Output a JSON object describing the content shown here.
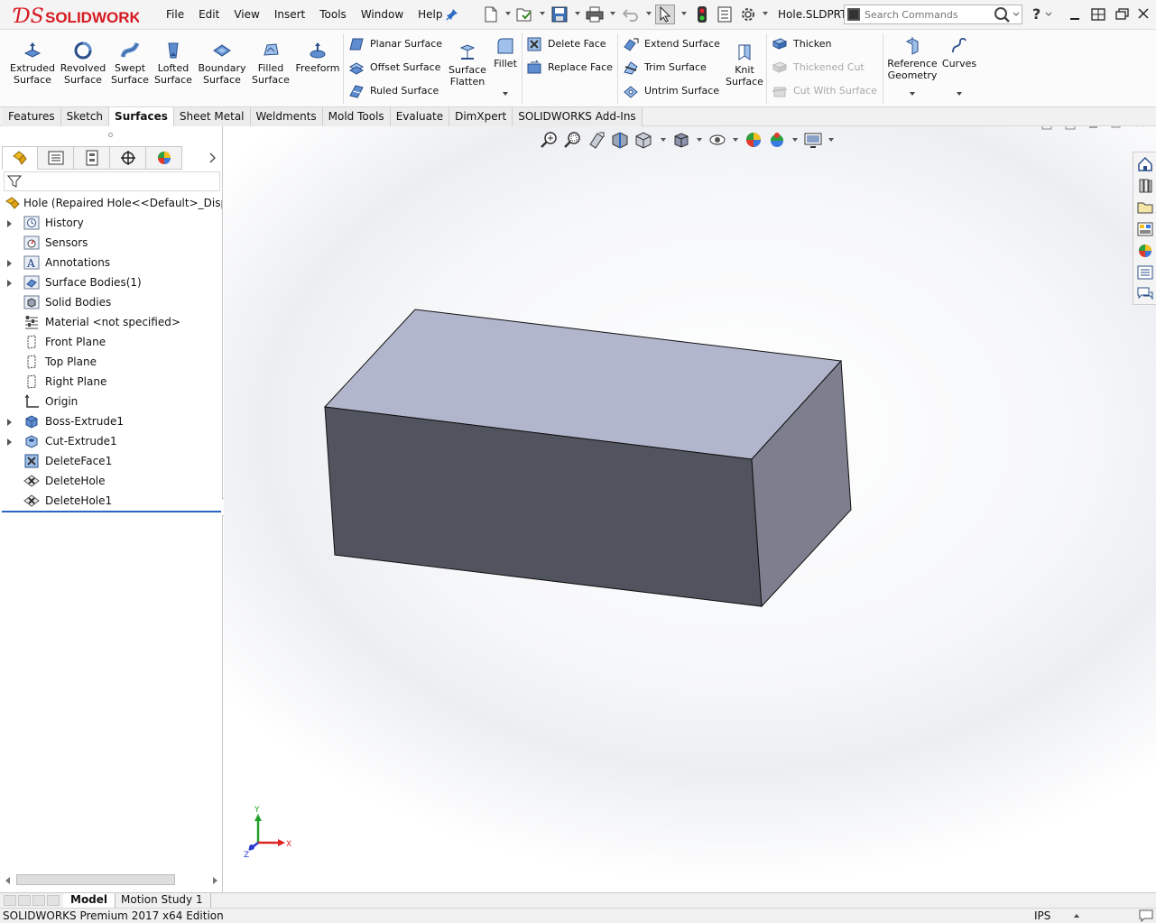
{
  "app": {
    "brand": "SOLIDWORKS",
    "document_title": "Hole.SLDPRT",
    "accent_color": "#d71920"
  },
  "menu": [
    "File",
    "Edit",
    "View",
    "Insert",
    "Tools",
    "Window",
    "Help"
  ],
  "search": {
    "placeholder": "Search Commands"
  },
  "ribbon": {
    "large": [
      {
        "label": "Extruded Surface"
      },
      {
        "label": "Revolved Surface"
      },
      {
        "label": "Swept Surface"
      },
      {
        "label": "Lofted Surface"
      },
      {
        "label": "Boundary Surface"
      },
      {
        "label": "Filled Surface"
      },
      {
        "label": "Freeform"
      }
    ],
    "planar_surface": "Planar Surface",
    "offset_surface": "Offset Surface",
    "ruled_surface": "Ruled Surface",
    "surface_flatten": "Surface Flatten",
    "fillet": "Fillet",
    "delete_face": "Delete Face",
    "replace_face": "Replace Face",
    "extend_surface": "Extend Surface",
    "trim_surface": "Trim Surface",
    "untrim_surface": "Untrim Surface",
    "knit_surface": "Knit Surface",
    "thicken": "Thicken",
    "thickened_cut": "Thickened Cut",
    "cut_with_surface": "Cut With Surface",
    "reference_geometry": "Reference Geometry",
    "curves": "Curves"
  },
  "command_tabs": [
    {
      "label": "Features",
      "active": false
    },
    {
      "label": "Sketch",
      "active": false
    },
    {
      "label": "Surfaces",
      "active": true
    },
    {
      "label": "Sheet Metal",
      "active": false
    },
    {
      "label": "Weldments",
      "active": false
    },
    {
      "label": "Mold Tools",
      "active": false
    },
    {
      "label": "Evaluate",
      "active": false
    },
    {
      "label": "DimXpert",
      "active": false
    },
    {
      "label": "SOLIDWORKS Add-Ins",
      "active": false
    }
  ],
  "tree": {
    "root": "Hole  (Repaired Hole<<Default>_Display",
    "items": [
      {
        "label": "History",
        "expandable": true
      },
      {
        "label": "Sensors",
        "expandable": false
      },
      {
        "label": "Annotations",
        "expandable": true
      },
      {
        "label": "Surface Bodies(1)",
        "expandable": true
      },
      {
        "label": "Solid Bodies",
        "expandable": false
      },
      {
        "label": "Material <not specified>",
        "expandable": false
      },
      {
        "label": "Front Plane",
        "expandable": false
      },
      {
        "label": "Top Plane",
        "expandable": false
      },
      {
        "label": "Right Plane",
        "expandable": false
      },
      {
        "label": "Origin",
        "expandable": false
      },
      {
        "label": "Boss-Extrude1",
        "expandable": true
      },
      {
        "label": "Cut-Extrude1",
        "expandable": true
      },
      {
        "label": "DeleteFace1",
        "expandable": false
      },
      {
        "label": "DeleteHole",
        "expandable": false
      },
      {
        "label": "DeleteHole1",
        "expandable": false
      }
    ]
  },
  "triad": {
    "x": "X",
    "y": "Y",
    "z": "Z"
  },
  "bottom_tabs": [
    {
      "label": "Model",
      "active": true
    },
    {
      "label": "Motion Study 1",
      "active": false
    }
  ],
  "status": {
    "text": "SOLIDWORKS Premium 2017 x64 Edition",
    "units": "IPS"
  },
  "colors": {
    "box_top": "#b2b6cc",
    "box_front": "#51545f",
    "box_right": "#7d7f8f",
    "selection_line": "#2a66c4"
  }
}
